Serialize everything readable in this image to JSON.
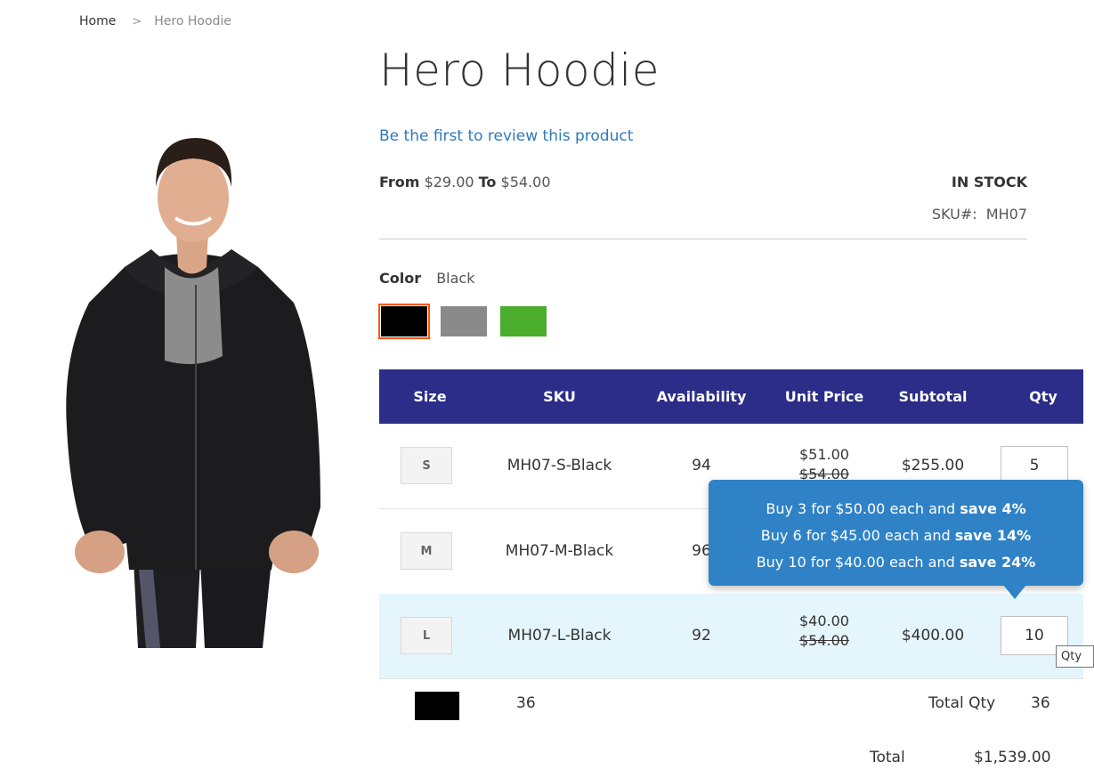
{
  "breadcrumb": {
    "home": "Home",
    "separator": ">",
    "current": "Hero Hoodie"
  },
  "product": {
    "title": "Hero Hoodie",
    "review_link": "Be the first to review this product",
    "price_from_label": "From",
    "price_from": "$29.00",
    "price_to_label": "To",
    "price_to": "$54.00",
    "stock": "IN STOCK",
    "sku_label": "SKU#:",
    "sku": "MH07"
  },
  "color": {
    "label": "Color",
    "selected": "Black",
    "swatches": [
      {
        "name": "Black",
        "hex": "#000000"
      },
      {
        "name": "Gray",
        "hex": "#8a8a8a"
      },
      {
        "name": "Green",
        "hex": "#4aad2c"
      }
    ]
  },
  "table": {
    "headers": [
      "Size",
      "SKU",
      "Availability",
      "Unit Price",
      "Subtotal",
      "Qty"
    ],
    "rows": [
      {
        "size": "S",
        "sku": "MH07-S-Black",
        "availability": "94",
        "price": "$51.00",
        "old_price": "$54.00",
        "subtotal": "$255.00",
        "qty": "5"
      },
      {
        "size": "M",
        "sku": "MH07-M-Black",
        "availability": "96",
        "price": "",
        "old_price": "",
        "subtotal": "",
        "qty": ""
      },
      {
        "size": "L",
        "sku": "MH07-L-Black",
        "availability": "92",
        "price": "$40.00",
        "old_price": "$54.00",
        "subtotal": "$400.00",
        "qty": "10"
      }
    ]
  },
  "tier_tooltip": {
    "lines": [
      {
        "text": "Buy 3 for $50.00 each and ",
        "bold": "save 4%"
      },
      {
        "text": "Buy 6 for $45.00 each and ",
        "bold": "save 14%"
      },
      {
        "text": "Buy 10 for $40.00 each and ",
        "bold": "save 24%"
      }
    ]
  },
  "qty_tooltip": "Qty",
  "summary": {
    "swatch_hex": "#000000",
    "count": "36",
    "total_qty_label": "Total Qty",
    "total_qty": "36",
    "total_label": "Total",
    "total": "$1,539.00"
  },
  "colors": {
    "header_bg": "#2b2d88",
    "link": "#2f7ab8",
    "highlight_row": "#e4f5fc",
    "tooltip_bg": "#2f82c6",
    "selected_outline": "#ff5501"
  }
}
